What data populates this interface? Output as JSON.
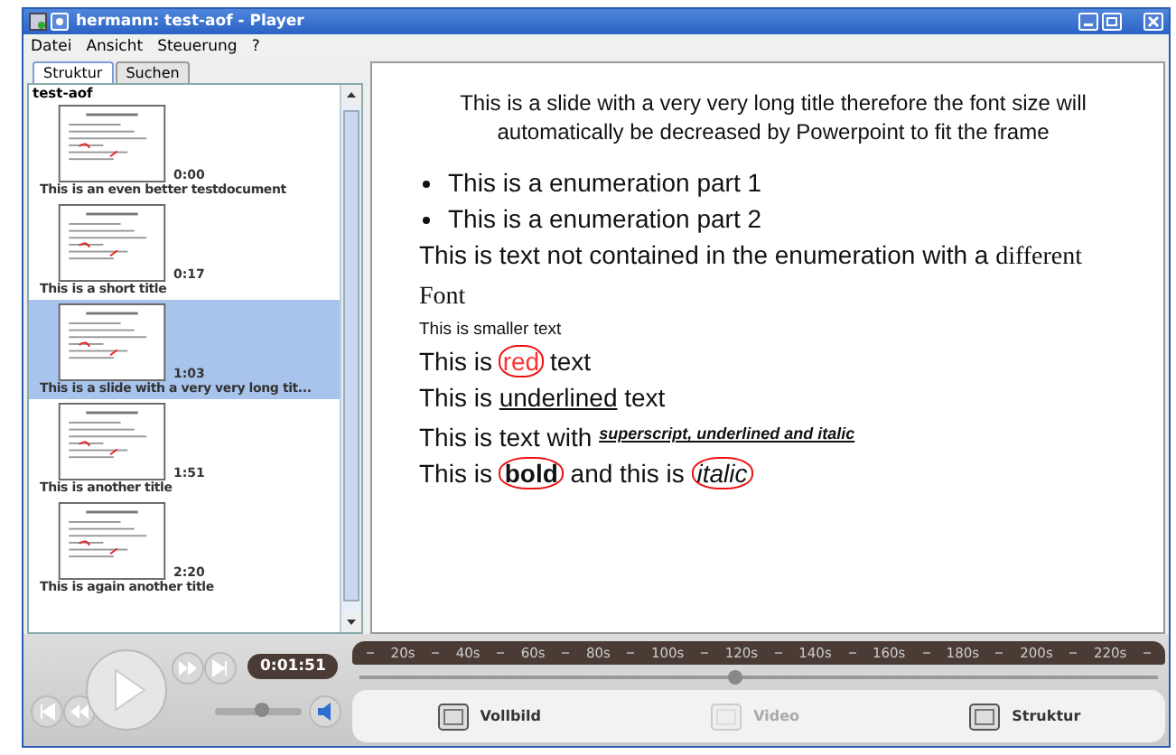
{
  "window": {
    "title": "hermann: test-aof - Player"
  },
  "menu": [
    "Datei",
    "Ansicht",
    "Steuerung",
    "?"
  ],
  "sidebar": {
    "tabs": [
      {
        "label": "Struktur",
        "selected": true
      },
      {
        "label": "Suchen",
        "selected": false
      }
    ],
    "root": "test-aof",
    "slides": [
      {
        "time": "0:00",
        "title": "This is an even better testdocument",
        "selected": false
      },
      {
        "time": "0:17",
        "title": "This is a short title",
        "selected": false
      },
      {
        "time": "1:03",
        "title": "This is a slide with a very very long tit...",
        "selected": true
      },
      {
        "time": "1:51",
        "title": "This is another title",
        "selected": false
      },
      {
        "time": "2:20",
        "title": "This is again another title",
        "selected": false
      }
    ]
  },
  "slide": {
    "title": "This is a slide with a very very long title therefore the font size will automatically be decreased by Powerpoint to fit the frame",
    "lines": [
      {
        "kind": "bullet",
        "parts": [
          {
            "kind": "plain",
            "text": "This is a enumeration part 1"
          }
        ]
      },
      {
        "kind": "bullet",
        "parts": [
          {
            "kind": "plain",
            "text": "This is a enumeration part 2"
          }
        ]
      },
      {
        "kind": "text",
        "parts": [
          {
            "kind": "plain",
            "text": "This is text not contained in the enumeration with a "
          },
          {
            "kind": "serif",
            "text": "different Font"
          }
        ]
      },
      {
        "kind": "small",
        "parts": [
          {
            "kind": "plain",
            "text": "This is smaller text"
          }
        ]
      },
      {
        "kind": "text",
        "parts": [
          {
            "kind": "plain",
            "text": "This is "
          },
          {
            "kind": "red",
            "text": "red"
          },
          {
            "kind": "plain",
            "text": " text"
          }
        ]
      },
      {
        "kind": "text",
        "parts": [
          {
            "kind": "plain",
            "text": "This is "
          },
          {
            "kind": "underline",
            "text": "underlined"
          },
          {
            "kind": "plain",
            "text": " text"
          }
        ]
      },
      {
        "kind": "text",
        "parts": [
          {
            "kind": "plain",
            "text": "This is text with "
          },
          {
            "kind": "sup",
            "text": "superscript, underlined and italic"
          }
        ]
      },
      {
        "kind": "text",
        "parts": [
          {
            "kind": "plain",
            "text": "This is "
          },
          {
            "kind": "bold",
            "text": "bold"
          },
          {
            "kind": "plain",
            "text": " and this is "
          },
          {
            "kind": "italic",
            "text": "italic"
          }
        ]
      }
    ]
  },
  "player": {
    "time": "0:01:51",
    "volume": {
      "level": 0.55
    },
    "timeline": {
      "ticks": [
        "20s",
        "40s",
        "60s",
        "80s",
        "100s",
        "120s",
        "140s",
        "160s",
        "180s",
        "200s",
        "220s"
      ],
      "level": 0.47
    },
    "views": [
      {
        "label": "Vollbild",
        "disabled": false
      },
      {
        "label": "Video",
        "disabled": true
      },
      {
        "label": "Struktur",
        "disabled": false
      }
    ]
  }
}
